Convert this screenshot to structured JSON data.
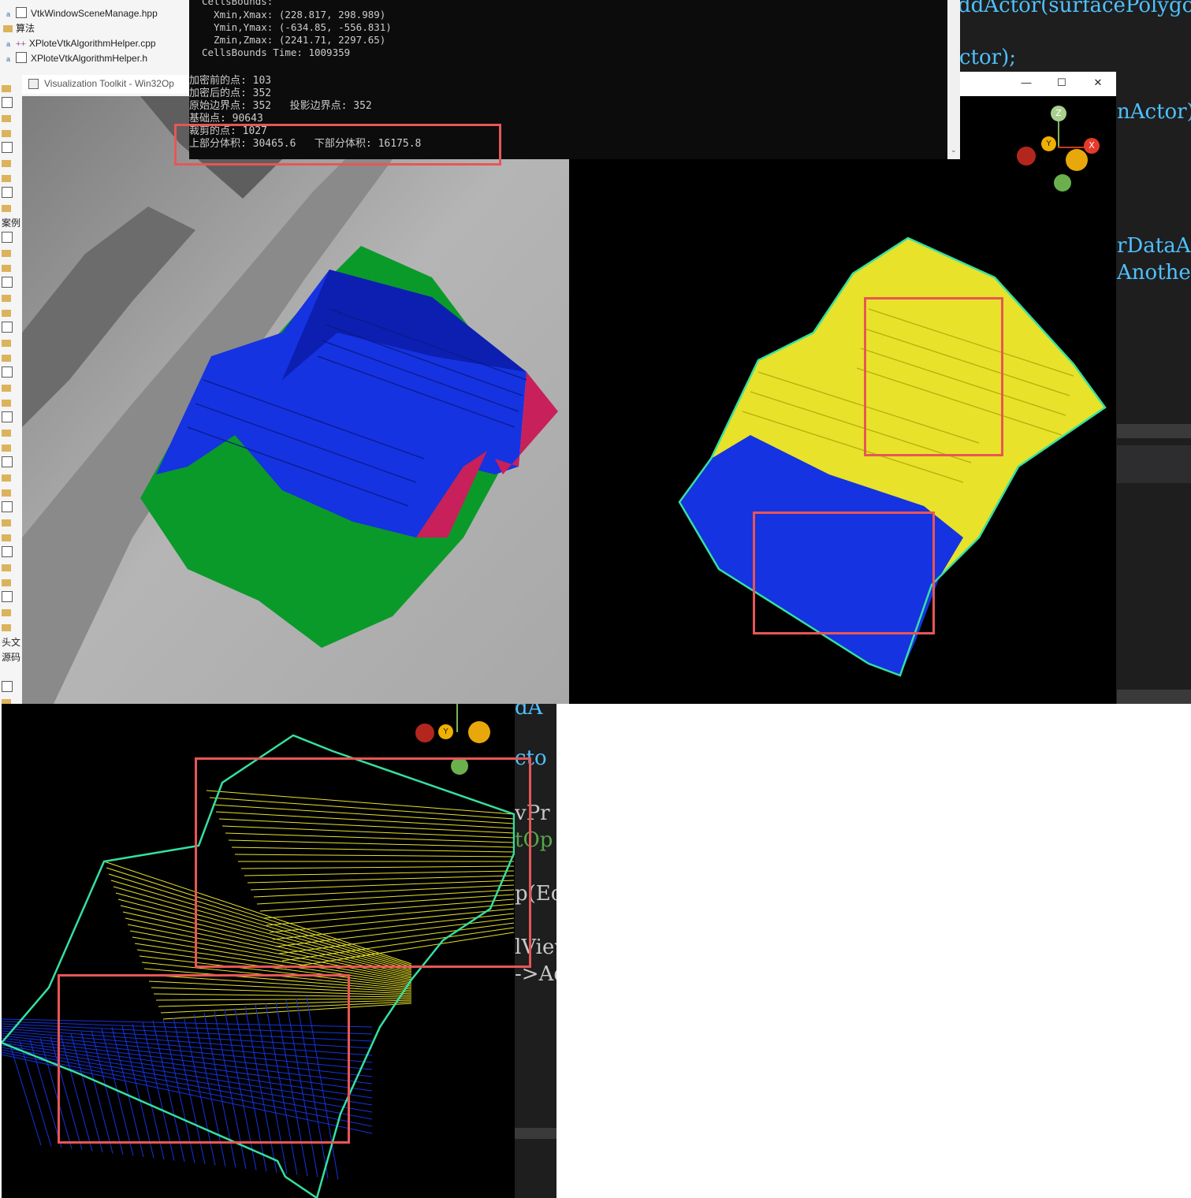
{
  "ide": {
    "tree_rows": [
      {
        "label": "VtkWindowSceneManage.hpp",
        "type": "file"
      },
      {
        "label": "算法",
        "type": "folder"
      },
      {
        "label": "XPloteVtkAlgorithmHelper.cpp",
        "type": "cpp"
      },
      {
        "label": "XPloteVtkAlgorithmHelper.h",
        "type": "file"
      }
    ],
    "side_labels": [
      "案例",
      "头文",
      "源码"
    ]
  },
  "console": {
    "lines": [
      "CellsBounds:",
      "  Xmin,Xmax: (228.817, 298.989)",
      "  Ymin,Ymax: (-634.85, -556.831)",
      "  Zmin,Zmax: (2241.71, 2297.65)",
      "CellsBounds Time: 1009359",
      "",
      "加密前的点: 103",
      "加密后的点: 352",
      "原始边界点: 352   投影边界点: 352",
      "基础点: 90643",
      "裁剪的点: 1027",
      "上部分体积: 30465.6   下部分体积: 16175.8"
    ]
  },
  "vtk_window": {
    "title": "Visualization Toolkit - Win32Op",
    "minimize": "—",
    "maximize": "☐",
    "close": "✕"
  },
  "axes_widget": {
    "x": "X",
    "y": "Y",
    "z": "Z"
  },
  "code_right": [
    {
      "text": "ddActor(surfacePolygon",
      "color": "#4fc1ff"
    },
    {
      "text": "ctor);",
      "color": "#4fc1ff"
    },
    {
      "text": "nActor)",
      "color": "#4fc1ff"
    },
    {
      "text": "rDataAc",
      "color": "#4fc1ff"
    },
    {
      "text": "Anothea",
      "color": "#4fc1ff"
    }
  ],
  "code_bottom": [
    {
      "text": "dA",
      "color": "#4fc1ff"
    },
    {
      "text": "cto",
      "color": "#4fc1ff"
    },
    {
      "text": "vPr",
      "color": "#c8c8c8"
    },
    {
      "text": "tOp",
      "color": "#57a64a"
    },
    {
      "text": "p(Ec",
      "color": "#c8c8c8"
    },
    {
      "text": "lView",
      "color": "#c8c8c8"
    },
    {
      "text": "->Add",
      "color": "#c8c8c8"
    }
  ],
  "colors": {
    "upper": "#e8e22a",
    "lower": "#1533e0",
    "outline": "#35e0a0",
    "highlight": "#e85656",
    "green_surface": "#0a9a2a",
    "magenta": "#c8205a"
  }
}
